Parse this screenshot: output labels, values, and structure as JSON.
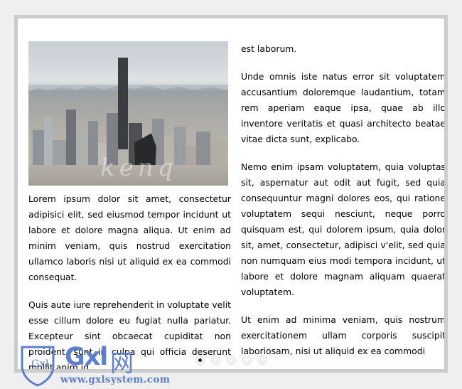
{
  "panel": {
    "background_color": "#ffffff",
    "border_color": "#cccccc",
    "page_background_color": "#efefef"
  },
  "slide": {
    "photo": {
      "alt": "Aerial photograph of the Seattle downtown skyline with high-rise office towers, city streets and distant mountain ridge on a hazy day",
      "watermark_text": "kenq"
    },
    "left_column": {
      "paragraphs": [
        "Lorem ipsum dolor sit amet, consectetur adipisici elit, sed eiusmod tempor incidunt ut labore et dolore magna aliqua. Ut enim ad minim veniam, quis nostrud exercitation ullamco laboris nisi ut aliquid ex ea commodi consequat.",
        "Quis aute iure reprehenderit in voluptate velit esse cillum dolore eu fugiat nulla pariatur. Excepteur sint obcaecat cupiditat non proident, sunt in culpa qui officia deserunt mollit anim id"
      ]
    },
    "right_column": {
      "paragraphs": [
        "est laborum.",
        "Unde omnis iste natus error sit voluptatem accusantium doloremque laudantium, totam rem aperiam eaque ipsa, quae ab illo inventore veritatis et quasi architecto beatae vitae dicta sunt, explicabo.",
        "Nemo enim ipsam voluptatem, quia voluptas sit, aspernatur aut odit aut fugit, sed quia consequuntur magni dolores eos, qui ratione voluptatem sequi nesciunt, neque porro quisquam est, qui dolorem ipsum, quia dolor sit, amet, consectetur, adipisci v'elit, sed quia non numquam eius modi tempora incidunt, ut labore et dolore magnam aliquam quaerat voluptatem.",
        "Ut enim ad minima veniam, quis nostrum exercitationem ullam corporis suscipit laboriosam, nisi ut aliquid ex ea commodi"
      ]
    }
  },
  "pagination": {
    "total": 5,
    "active_index": 0,
    "items": [
      {
        "label": "1",
        "active": true
      },
      {
        "label": "2",
        "active": false
      },
      {
        "label": "3",
        "active": false
      },
      {
        "label": "4",
        "active": false
      },
      {
        "label": "5",
        "active": false
      }
    ]
  },
  "watermark": {
    "shield_label": "Gxl",
    "wordmark": "Gxl",
    "cjk": "网",
    "url": "www.gxlsystem.com",
    "color": "#5d7fd0"
  }
}
